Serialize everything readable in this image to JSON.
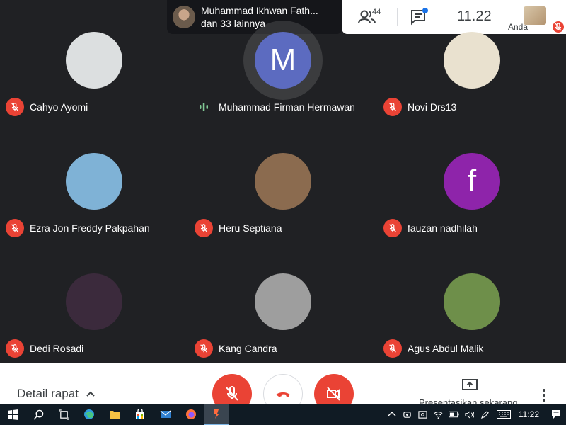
{
  "presenter": {
    "line1": "Muhammad Ikhwan Fath...",
    "line2": "dan 33 lainnya"
  },
  "topbar": {
    "people_count": "44",
    "time": "11.22",
    "self_label": "Anda"
  },
  "participants": [
    {
      "name": "Cahyo Ayomi",
      "initial": "",
      "avatar_bg": "#dcdfe0"
    },
    {
      "name": "Muhammad Firman Hermawan",
      "initial": "M",
      "avatar_bg": "#5c6bc0"
    },
    {
      "name": "Novi Drs13",
      "initial": "",
      "avatar_bg": "#e9e1cf"
    },
    {
      "name": "Ezra Jon Freddy Pakpahan",
      "initial": "",
      "avatar_bg": "#7fb2d6"
    },
    {
      "name": "Heru Septiana",
      "initial": "",
      "avatar_bg": "#8b6b4f"
    },
    {
      "name": "fauzan nadhilah",
      "initial": "f",
      "avatar_bg": "#8e24aa"
    },
    {
      "name": "Dedi Rosadi",
      "initial": "",
      "avatar_bg": "#3b2a3c"
    },
    {
      "name": "Kang Candra",
      "initial": "",
      "avatar_bg": "#9e9e9e"
    },
    {
      "name": "Agus Abdul Malik",
      "initial": "",
      "avatar_bg": "#6e8f4a"
    }
  ],
  "bottom": {
    "details_label": "Detail rapat",
    "present_label": "Presentasikan sekarang"
  },
  "taskbar": {
    "time": "11:22"
  }
}
